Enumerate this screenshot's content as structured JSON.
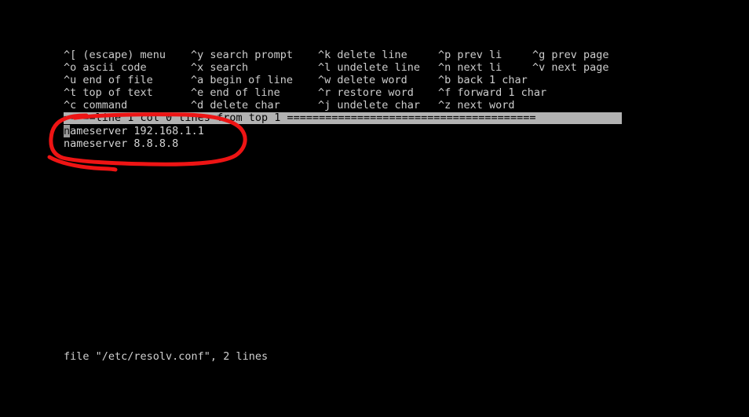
{
  "terminal": {
    "background_color": "#000000",
    "foreground_color": "#cfcfcf",
    "app": "ee",
    "file_name": "/etc/resolv.conf"
  },
  "help": {
    "rows": [
      [
        {
          "key": "^[",
          "label": "(escape) menu"
        },
        {
          "key": "^y",
          "label": "search prompt"
        },
        {
          "key": "^k",
          "label": "delete line"
        },
        {
          "key": "^p",
          "label": "prev li"
        },
        {
          "key": "^g",
          "label": "prev page"
        }
      ],
      [
        {
          "key": "^o",
          "label": "ascii code"
        },
        {
          "key": "^x",
          "label": "search"
        },
        {
          "key": "^l",
          "label": "undelete line"
        },
        {
          "key": "^n",
          "label": "next li"
        },
        {
          "key": "^v",
          "label": "next page"
        }
      ],
      [
        {
          "key": "^u",
          "label": "end of file"
        },
        {
          "key": "^a",
          "label": "begin of line"
        },
        {
          "key": "^w",
          "label": "delete word"
        },
        {
          "key": "^b",
          "label": "back 1 char"
        },
        {
          "key": "",
          "label": ""
        }
      ],
      [
        {
          "key": "^t",
          "label": "top of text"
        },
        {
          "key": "^e",
          "label": "end of line"
        },
        {
          "key": "^r",
          "label": "restore word"
        },
        {
          "key": "^f",
          "label": "forward 1 char"
        },
        {
          "key": "",
          "label": ""
        }
      ],
      [
        {
          "key": "^c",
          "label": "command"
        },
        {
          "key": "^d",
          "label": "delete char"
        },
        {
          "key": "^j",
          "label": "undelete char"
        },
        {
          "key": "^z",
          "label": "next word"
        },
        {
          "key": "",
          "label": ""
        }
      ]
    ],
    "row_0_col_0": "^[ (escape) menu",
    "row_0_col_1": "^y search prompt",
    "row_0_col_2": "^k delete line",
    "row_0_col_3": "^p prev li",
    "row_0_col_4": "^g prev page",
    "row_1_col_0": "^o ascii code",
    "row_1_col_1": "^x search",
    "row_1_col_2": "^l undelete line",
    "row_1_col_3": "^n next li",
    "row_1_col_4": "^v next page",
    "row_2_col_0": "^u end of file",
    "row_2_col_1": "^a begin of line",
    "row_2_col_2": "^w delete word",
    "row_2_col_3": "^b back 1 char",
    "row_2_col_4": "",
    "row_3_col_0": "^t top of text",
    "row_3_col_1": "^e end of line",
    "row_3_col_2": "^r restore word",
    "row_3_col_3": "^f forward 1 char",
    "row_3_col_4": "",
    "row_4_col_0": "^c command",
    "row_4_col_1": "^d delete char",
    "row_4_col_2": "^j undelete char",
    "row_4_col_3": "^z next word",
    "row_4_col_4": ""
  },
  "status_bar": {
    "text": "=====line 1 col 0 lines from top 1 =======================================",
    "line": 1,
    "col": 0,
    "lines_from_top": 1,
    "background_color": "#b2b2b2",
    "text_color": "#000000"
  },
  "buffer": {
    "lines": [
      {
        "cursor_char": "n",
        "rest": "ameserver 192.168.1.1"
      },
      {
        "cursor_char": "",
        "rest": "nameserver 8.8.8.8"
      }
    ],
    "line_0_cursor": "n",
    "line_0_rest": "ameserver 192.168.1.1",
    "line_1_text": "nameserver 8.8.8.8"
  },
  "file_status": {
    "text": "file \"/etc/resolv.conf\", 2 lines"
  },
  "annotation": {
    "color": "#ee1414",
    "shape": "hand-drawn-ellipse-with-tail",
    "description": "red circle around the two nameserver lines"
  }
}
